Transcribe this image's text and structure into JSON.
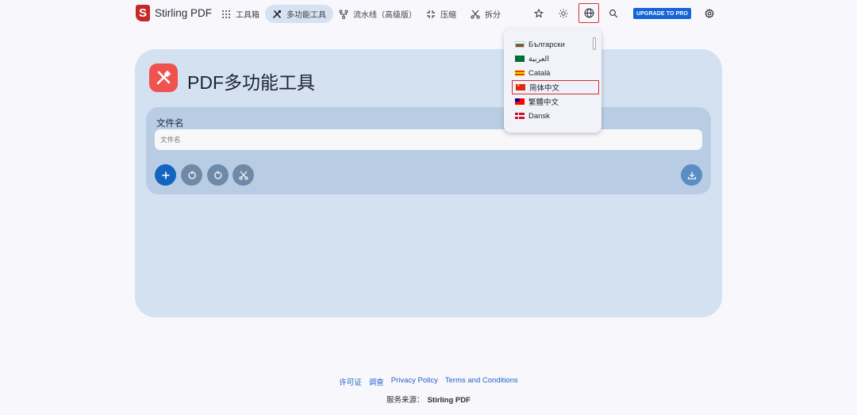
{
  "brand": {
    "logo_letter": "S",
    "name": "Stirling PDF"
  },
  "nav": {
    "toolbox": "工具箱",
    "multitool": "多功能工具",
    "pipeline": "流水线（高级版）",
    "compress": "压缩",
    "split": "拆分",
    "upgrade": "UPGRADE TO PRO"
  },
  "page": {
    "title": "PDF多功能工具"
  },
  "form": {
    "filename_label": "文件名",
    "filename_placeholder": "文件名"
  },
  "languages": [
    {
      "label": "Български",
      "flag": "bg"
    },
    {
      "label": "العربية",
      "flag": "sa"
    },
    {
      "label": "Català",
      "flag": "catalonia"
    },
    {
      "label": "简体中文",
      "flag": "cn",
      "selected": true
    },
    {
      "label": "繁體中文",
      "flag": "tw"
    },
    {
      "label": "Dansk",
      "flag": "dk"
    }
  ],
  "footer": {
    "links": [
      "许可证",
      "调查",
      "Privacy Policy",
      "Terms and Conditions"
    ],
    "powered_by_label": "服务来源：",
    "powered_by_name": "Stirling PDF"
  },
  "colors": {
    "accent": "#1565c0",
    "card_bg": "#d4e1f1",
    "inner_bg": "#b8cde4",
    "brand_red": "#c62828",
    "highlight_border": "#d32f2f"
  }
}
